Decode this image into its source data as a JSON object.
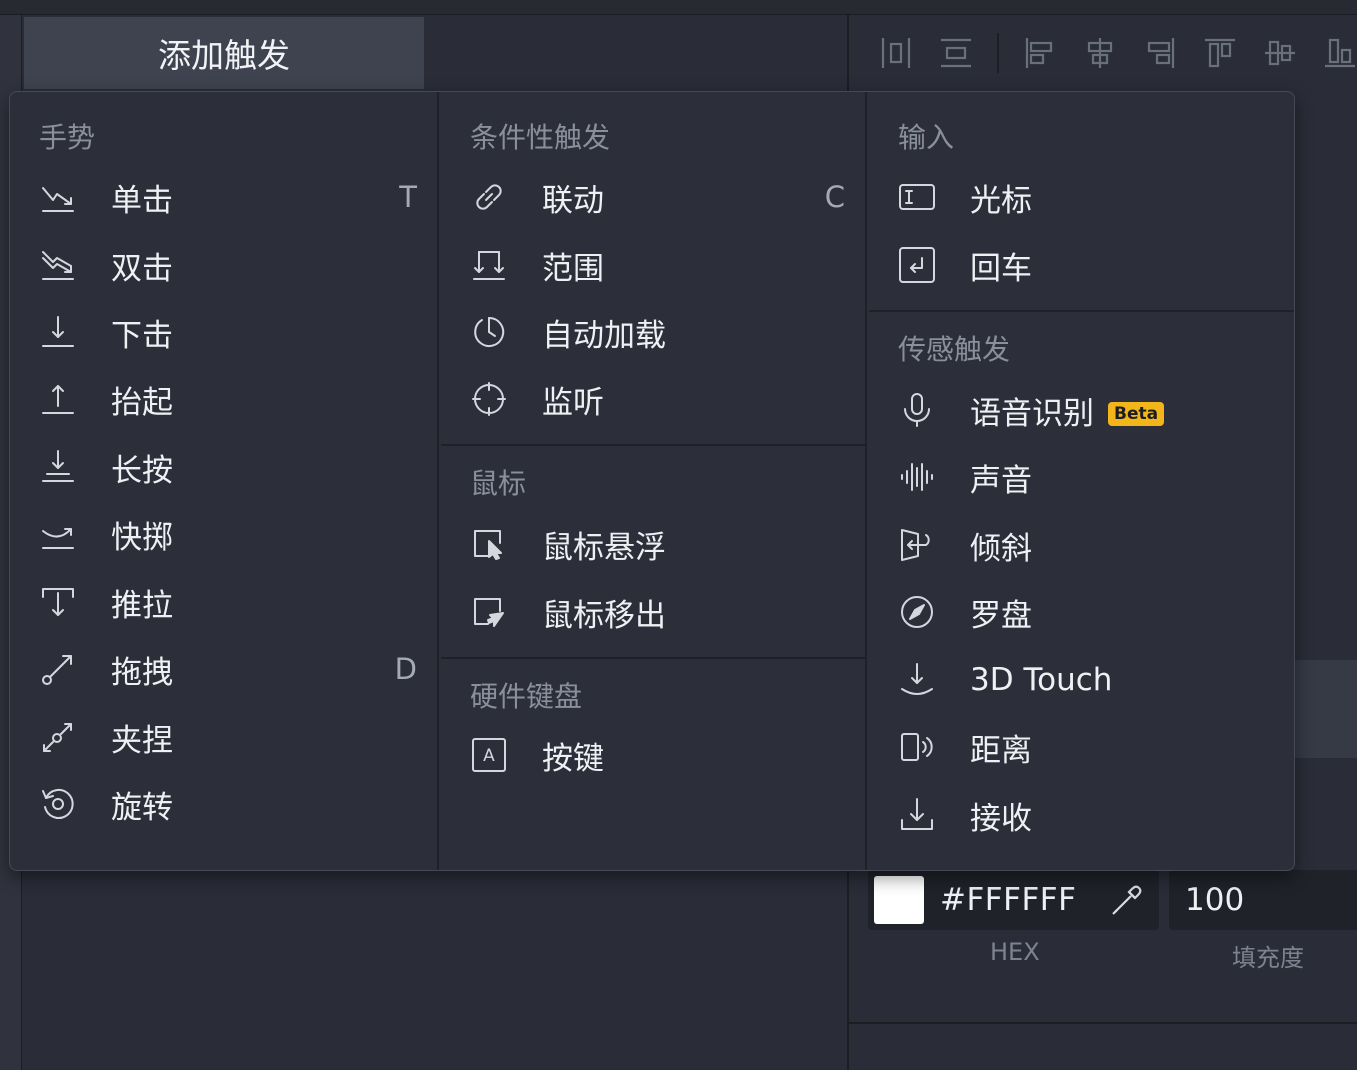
{
  "header": {
    "add_trigger_label": "添加触发"
  },
  "toolbar": {
    "icons": [
      "distribute-horizontal-icon",
      "distribute-vertical-icon",
      "align-left-icon",
      "align-center-horizontal-icon",
      "align-right-icon",
      "align-top-icon",
      "align-middle-vertical-icon",
      "align-bottom-icon"
    ]
  },
  "fill": {
    "hex": "#FFFFFF",
    "hex_label": "HEX",
    "opacity": "100",
    "opacity_label": "填充度",
    "swatch_color": "#FFFFFF"
  },
  "menu": {
    "gestures": {
      "title": "手势",
      "items": [
        {
          "label": "单击",
          "shortcut": "T",
          "icon": "tap-icon"
        },
        {
          "label": "双击",
          "shortcut": "",
          "icon": "double-tap-icon"
        },
        {
          "label": "下击",
          "shortcut": "",
          "icon": "touch-down-icon"
        },
        {
          "label": "抬起",
          "shortcut": "",
          "icon": "touch-up-icon"
        },
        {
          "label": "长按",
          "shortcut": "",
          "icon": "long-press-icon"
        },
        {
          "label": "快掷",
          "shortcut": "",
          "icon": "swipe-icon"
        },
        {
          "label": "推拉",
          "shortcut": "",
          "icon": "pull-icon"
        },
        {
          "label": "拖拽",
          "shortcut": "D",
          "icon": "drag-icon"
        },
        {
          "label": "夹捏",
          "shortcut": "",
          "icon": "pinch-icon"
        },
        {
          "label": "旋转",
          "shortcut": "",
          "icon": "rotate-icon"
        }
      ]
    },
    "conditional": {
      "title": "条件性触发",
      "items": [
        {
          "label": "联动",
          "shortcut": "C",
          "icon": "link-icon"
        },
        {
          "label": "范围",
          "shortcut": "",
          "icon": "range-icon"
        },
        {
          "label": "自动加载",
          "shortcut": "",
          "icon": "auto-load-icon"
        },
        {
          "label": "监听",
          "shortcut": "",
          "icon": "listen-icon"
        }
      ]
    },
    "mouse": {
      "title": "鼠标",
      "items": [
        {
          "label": "鼠标悬浮",
          "icon": "mouse-hover-icon"
        },
        {
          "label": "鼠标移出",
          "icon": "mouse-out-icon"
        }
      ]
    },
    "keyboard": {
      "title": "硬件键盘",
      "items": [
        {
          "label": "按键",
          "icon": "key-icon"
        }
      ]
    },
    "input": {
      "title": "输入",
      "items": [
        {
          "label": "光标",
          "icon": "cursor-icon"
        },
        {
          "label": "回车",
          "icon": "enter-icon"
        }
      ]
    },
    "sensor": {
      "title": "传感触发",
      "beta_label": "Beta",
      "items": [
        {
          "label": "语音识别",
          "icon": "microphone-icon"
        },
        {
          "label": "声音",
          "icon": "sound-wave-icon"
        },
        {
          "label": "倾斜",
          "icon": "tilt-icon"
        },
        {
          "label": "罗盘",
          "icon": "compass-icon"
        },
        {
          "label": "3D Touch",
          "icon": "3d-touch-icon"
        },
        {
          "label": "距离",
          "icon": "proximity-icon"
        },
        {
          "label": "接收",
          "icon": "receive-icon"
        }
      ]
    }
  }
}
